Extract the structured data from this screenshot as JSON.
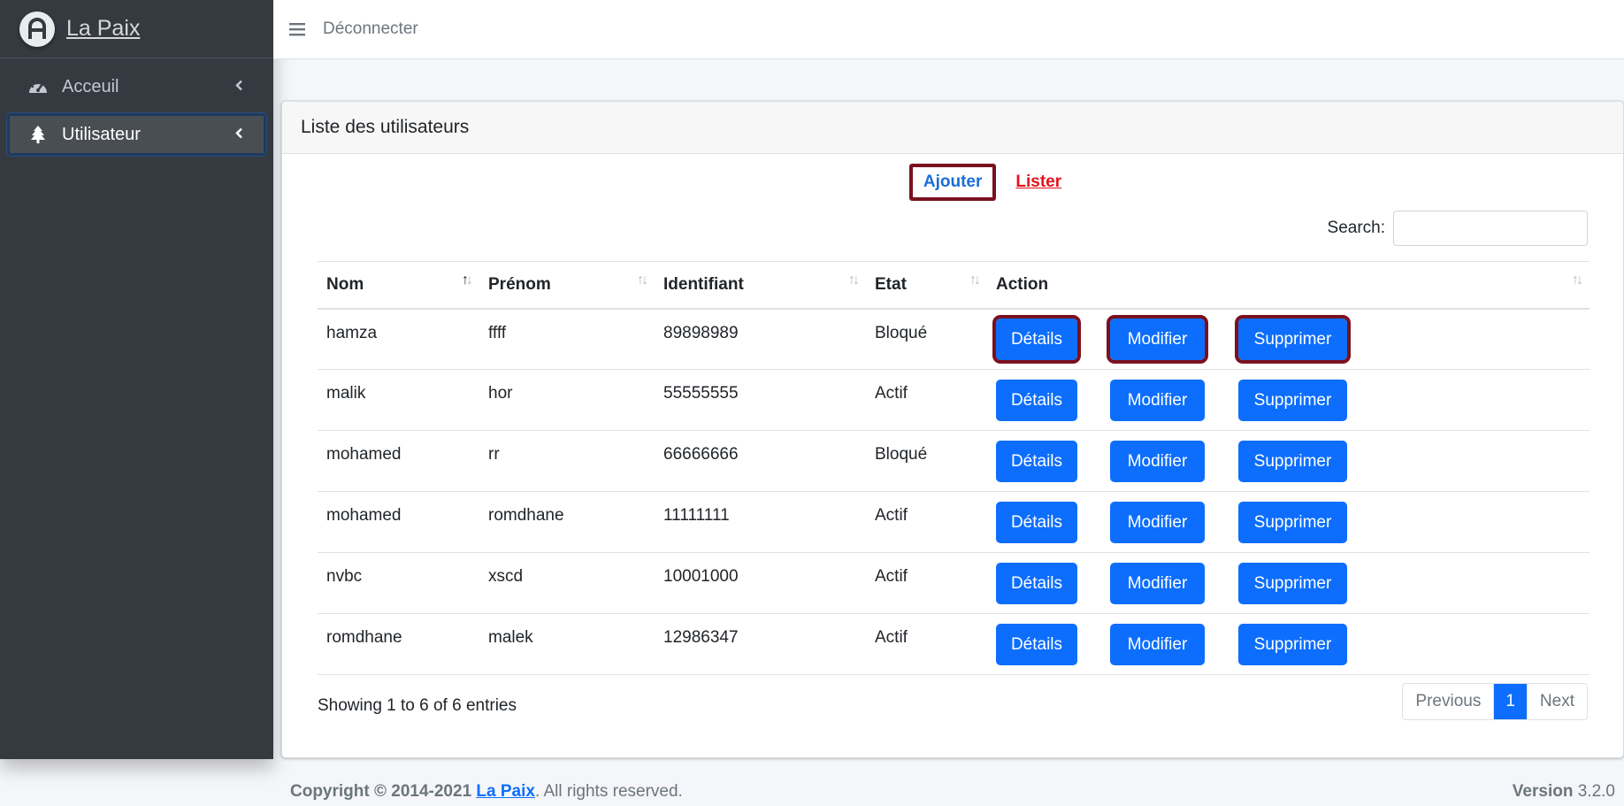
{
  "brand": {
    "name": "La Paix"
  },
  "sidebar": {
    "items": [
      {
        "label": "Acceuil",
        "icon": "tachometer-icon",
        "active": false
      },
      {
        "label": "Utilisateur",
        "icon": "tree-icon",
        "active": true
      }
    ]
  },
  "topbar": {
    "menu_icon": "hamburger-icon",
    "logout_label": "Déconnecter"
  },
  "card": {
    "title": "Liste des utilisateurs",
    "add_link": "Ajouter",
    "list_link": "Lister",
    "search_label": "Search:",
    "search_value": ""
  },
  "table": {
    "columns": [
      "Nom",
      "Prénom",
      "Identifiant",
      "Etat",
      "Action"
    ],
    "rows": [
      {
        "nom": "hamza",
        "prenom": "ffff",
        "identifiant": "89898989",
        "etat": "Bloqué"
      },
      {
        "nom": "malik",
        "prenom": "hor",
        "identifiant": "55555555",
        "etat": "Actif"
      },
      {
        "nom": "mohamed",
        "prenom": "rr",
        "identifiant": "66666666",
        "etat": "Bloqué"
      },
      {
        "nom": "mohamed",
        "prenom": "romdhane",
        "identifiant": "11111111",
        "etat": "Actif"
      },
      {
        "nom": "nvbc",
        "prenom": "xscd",
        "identifiant": "10001000",
        "etat": "Actif"
      },
      {
        "nom": "romdhane",
        "prenom": "malek",
        "identifiant": "12986347",
        "etat": "Actif"
      }
    ],
    "actions": {
      "details": "Détails",
      "modifier": "Modifier",
      "supprimer": "Supprimer"
    }
  },
  "pagination": {
    "info": "Showing 1 to 6 of 6 entries",
    "previous": "Previous",
    "current": "1",
    "next": "Next"
  },
  "footer": {
    "copyright_prefix": "Copyright © 2014-2021",
    "brand": "La Paix",
    "rights": ". All rights reserved.",
    "version_label": "Version",
    "version_value": "3.2.0"
  },
  "colors": {
    "sidebar": "#343a40",
    "primary": "#0d6efd",
    "highlight_border": "#7a1120",
    "lister": "#e3121d"
  }
}
